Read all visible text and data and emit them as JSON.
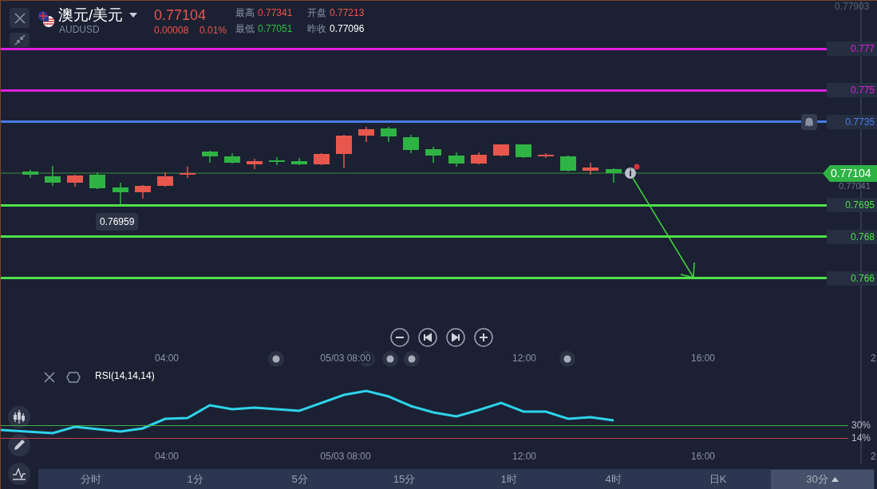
{
  "header": {
    "symbol_name": "澳元/美元",
    "symbol_code": "AUDUSD",
    "price": "0.77104",
    "change": "0.00008",
    "change_percent": "0.01%",
    "stats": [
      {
        "label": "最高",
        "value": "0.77341",
        "color": "#e8574d"
      },
      {
        "label": "最低",
        "value": "0.77051",
        "color": "#2fbf46"
      },
      {
        "label": "开盘",
        "value": "0.77213",
        "color": "#e8574d"
      },
      {
        "label": "昨收",
        "value": "0.77096",
        "color": "#ffffff"
      }
    ]
  },
  "price_axis": {
    "top_label": "0.77903",
    "current_price": "0.77104",
    "reference_price": "0.77041",
    "edge_labels": [
      "2",
      "2"
    ]
  },
  "price_lines": [
    {
      "price": "0.777",
      "color": "#e01ee0",
      "alert": false
    },
    {
      "price": "0.775",
      "color": "#e01ee0",
      "alert": false
    },
    {
      "price": "0.7735",
      "color": "#4a7be6",
      "alert": true
    },
    {
      "price": "0.7695",
      "color": "#4fe04b",
      "alert": false
    },
    {
      "price": "0.768",
      "color": "#4fe04b",
      "alert": false
    },
    {
      "price": "0.766",
      "color": "#4fe04b",
      "alert": false
    }
  ],
  "low_marker": "0.76959",
  "time_axis": [
    "04:00",
    "05/03 08:00",
    "12:00",
    "16:00"
  ],
  "rsi": {
    "title": "RSI(14,14,14)",
    "levels": [
      {
        "label": "30%",
        "color": "#3fae49"
      },
      {
        "label": "14%",
        "color": "#c0404f"
      }
    ]
  },
  "rsi_time_axis": [
    "04:00",
    "05/03 08:00",
    "12:00",
    "16:00"
  ],
  "timeframe_tabs": [
    {
      "label": "分时",
      "selected": false
    },
    {
      "label": "1分",
      "selected": false
    },
    {
      "label": "5分",
      "selected": false
    },
    {
      "label": "15分",
      "selected": false
    },
    {
      "label": "1时",
      "selected": false
    },
    {
      "label": "4时",
      "selected": false
    },
    {
      "label": "日K",
      "selected": false
    },
    {
      "label": "30分",
      "selected": true
    }
  ]
}
